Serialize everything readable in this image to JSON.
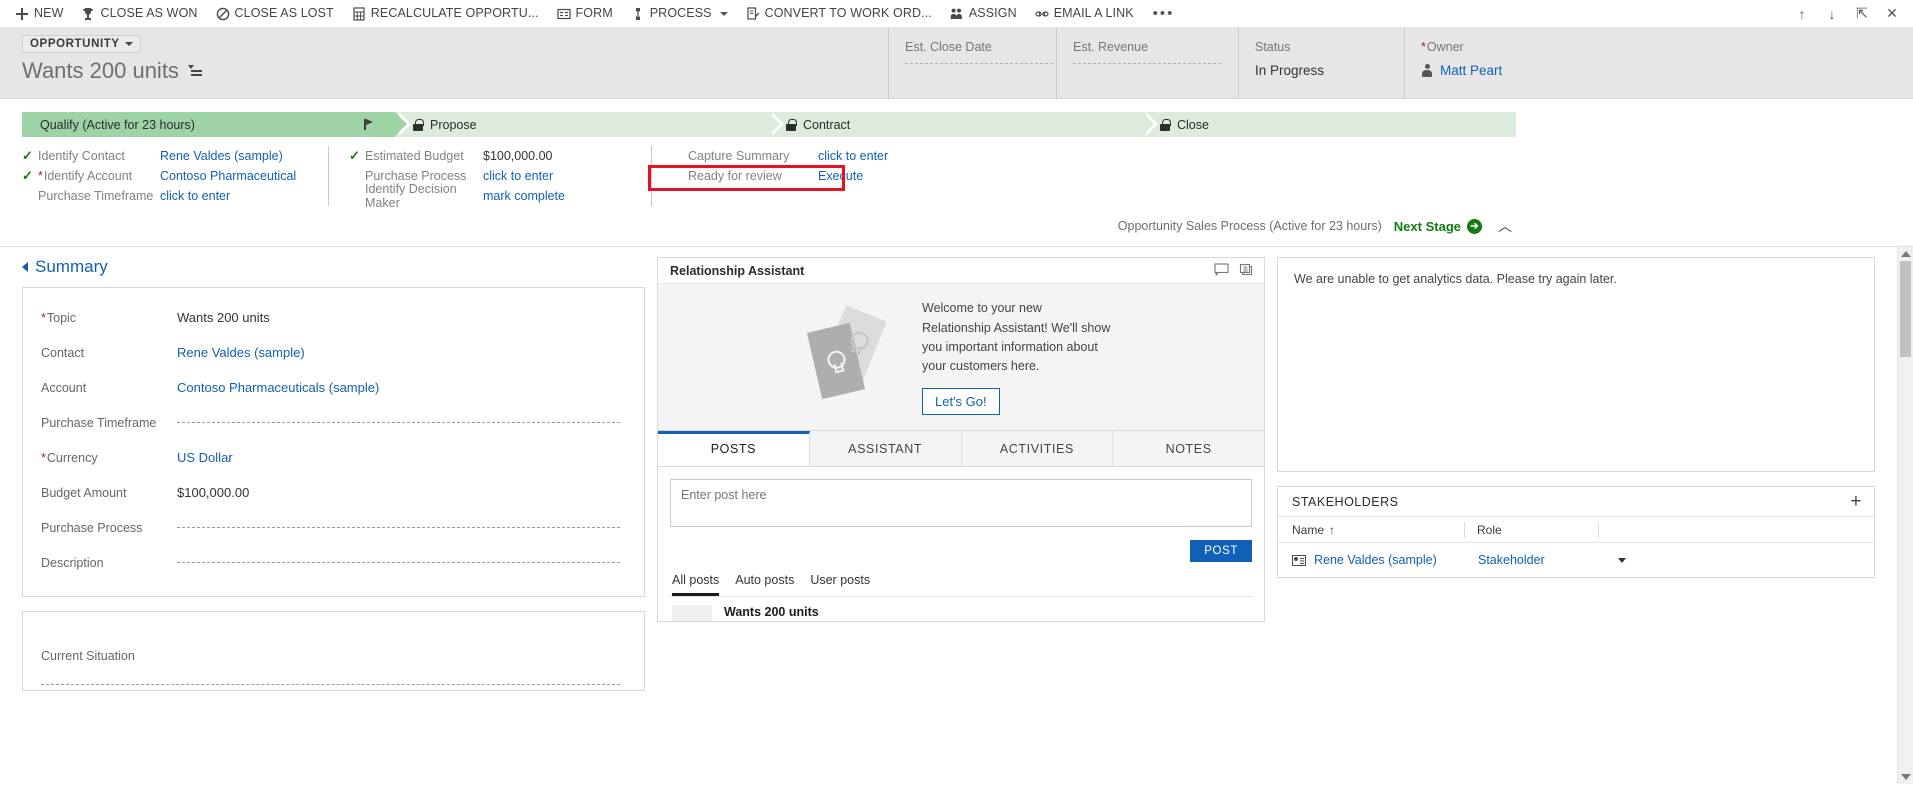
{
  "commandbar": {
    "items": [
      {
        "label": "NEW",
        "icon": "plus-icon",
        "caret": false
      },
      {
        "label": "CLOSE AS WON",
        "icon": "trophy-icon",
        "caret": false
      },
      {
        "label": "CLOSE AS LOST",
        "icon": "prohibited-icon",
        "caret": false
      },
      {
        "label": "RECALCULATE OPPORTU...",
        "icon": "calculator-icon",
        "caret": false
      },
      {
        "label": "FORM",
        "icon": "form-icon",
        "caret": false
      },
      {
        "label": "PROCESS",
        "icon": "process-icon",
        "caret": true
      },
      {
        "label": "CONVERT TO WORK ORD...",
        "icon": "convert-icon",
        "caret": false
      },
      {
        "label": "ASSIGN",
        "icon": "assign-icon",
        "caret": false
      },
      {
        "label": "EMAIL A LINK",
        "icon": "link-icon",
        "caret": false
      }
    ],
    "overflow_label": "•••",
    "window_buttons": [
      {
        "name": "up-arrow-icon",
        "glyph": "↑"
      },
      {
        "name": "down-arrow-icon",
        "glyph": "↓"
      },
      {
        "name": "popout-icon",
        "glyph": "⇱"
      },
      {
        "name": "close-icon",
        "glyph": "✕"
      }
    ]
  },
  "record_header": {
    "entity_type": "OPPORTUNITY",
    "title": "Wants 200 units",
    "fields": [
      {
        "label": "Est. Close Date",
        "value": "",
        "required": false,
        "empty": true
      },
      {
        "label": "Est. Revenue",
        "value": "",
        "required": false,
        "empty": true
      },
      {
        "label": "Status",
        "value": "In Progress",
        "required": false,
        "empty": false
      },
      {
        "label": "Owner",
        "value": "Matt Peart",
        "required": true,
        "empty": false
      }
    ]
  },
  "process": {
    "stages": [
      {
        "label": "Qualify (Active for 23 hours)",
        "state": "active",
        "locked": false
      },
      {
        "label": "Propose",
        "state": "inactive",
        "locked": true
      },
      {
        "label": "Contract",
        "state": "inactive",
        "locked": true
      },
      {
        "label": "Close",
        "state": "inactive",
        "locked": true
      }
    ],
    "columns": [
      {
        "name": "qualify",
        "rows": [
          {
            "checked": true,
            "required": false,
            "label": "Identify Contact",
            "value": "Rene Valdes (sample)",
            "link": true
          },
          {
            "checked": true,
            "required": true,
            "label": "Identify Account",
            "value": "Contoso Pharmaceutical",
            "link": true
          },
          {
            "checked": false,
            "required": false,
            "label": "Purchase Timeframe",
            "value": "click to enter",
            "link": true
          }
        ]
      },
      {
        "name": "propose",
        "rows": [
          {
            "checked": true,
            "required": false,
            "label": "Estimated Budget",
            "value": "$100,000.00",
            "link": false
          },
          {
            "checked": false,
            "required": false,
            "label": "Purchase Process",
            "value": "click to enter",
            "link": true
          },
          {
            "checked": false,
            "required": false,
            "label": "Identify Decision Maker",
            "value": "mark complete",
            "link": true
          }
        ]
      },
      {
        "name": "contract",
        "rows": [
          {
            "checked": false,
            "required": false,
            "label": "Capture Summary",
            "value": "click to enter",
            "link": true
          },
          {
            "checked": false,
            "required": false,
            "label": "Ready for review",
            "value": "Execute",
            "link": true
          }
        ]
      }
    ],
    "highlight_color": "#e81123",
    "footer": {
      "process_name": "Opportunity Sales Process (Active for 23 hours)",
      "next_stage_label": "Next Stage",
      "next_stage_color": "#107c10",
      "collapse_glyph": "︿"
    }
  },
  "summary": {
    "section_title": "Summary",
    "fields": [
      {
        "label": "Topic",
        "value": "Wants 200 units",
        "required": true,
        "link": false,
        "empty": false
      },
      {
        "label": "Contact",
        "value": "Rene Valdes (sample)",
        "required": false,
        "link": true,
        "empty": false
      },
      {
        "label": "Account",
        "value": "Contoso Pharmaceuticals (sample)",
        "required": false,
        "link": true,
        "empty": false
      },
      {
        "label": "Purchase Timeframe",
        "value": "",
        "required": false,
        "link": false,
        "empty": true
      },
      {
        "label": "Currency",
        "value": "US Dollar",
        "required": true,
        "link": true,
        "empty": false
      },
      {
        "label": "Budget Amount",
        "value": "$100,000.00",
        "required": false,
        "link": false,
        "empty": false
      },
      {
        "label": "Purchase Process",
        "value": "",
        "required": false,
        "link": false,
        "empty": true
      },
      {
        "label": "Description",
        "value": "",
        "required": false,
        "link": false,
        "empty": true
      }
    ],
    "second_card": [
      {
        "label": "Current Situation",
        "value": "",
        "required": false,
        "link": false,
        "empty": true
      }
    ]
  },
  "relationship_assistant": {
    "title": "Relationship Assistant",
    "header_icons": [
      {
        "name": "feedback-icon"
      },
      {
        "name": "cards-stack-icon"
      }
    ],
    "welcome_text": "Welcome to your new Relationship Assistant! We'll show you important information about your customers here.",
    "cta_label": "Let's Go!"
  },
  "social_pane": {
    "tabs": [
      {
        "label": "POSTS",
        "active": true
      },
      {
        "label": "ASSISTANT",
        "active": false
      },
      {
        "label": "ACTIVITIES",
        "active": false
      },
      {
        "label": "NOTES",
        "active": false
      }
    ],
    "post_placeholder": "Enter post here",
    "post_value": "",
    "post_button": "POST",
    "filters": [
      {
        "label": "All posts",
        "active": true
      },
      {
        "label": "Auto posts",
        "active": false
      },
      {
        "label": "User posts",
        "active": false
      }
    ],
    "feed": [
      {
        "title": "Wants 200 units"
      }
    ]
  },
  "analytics": {
    "message": "We are unable to get analytics data. Please try again later."
  },
  "stakeholders": {
    "title": "STAKEHOLDERS",
    "add_label": "+",
    "columns": [
      {
        "label": "Name",
        "sort": "↑"
      },
      {
        "label": "Role",
        "sort": ""
      },
      {
        "label": "",
        "sort": ""
      }
    ],
    "rows": [
      {
        "name": "Rene Valdes (sample)",
        "role": "Stakeholder"
      }
    ]
  }
}
